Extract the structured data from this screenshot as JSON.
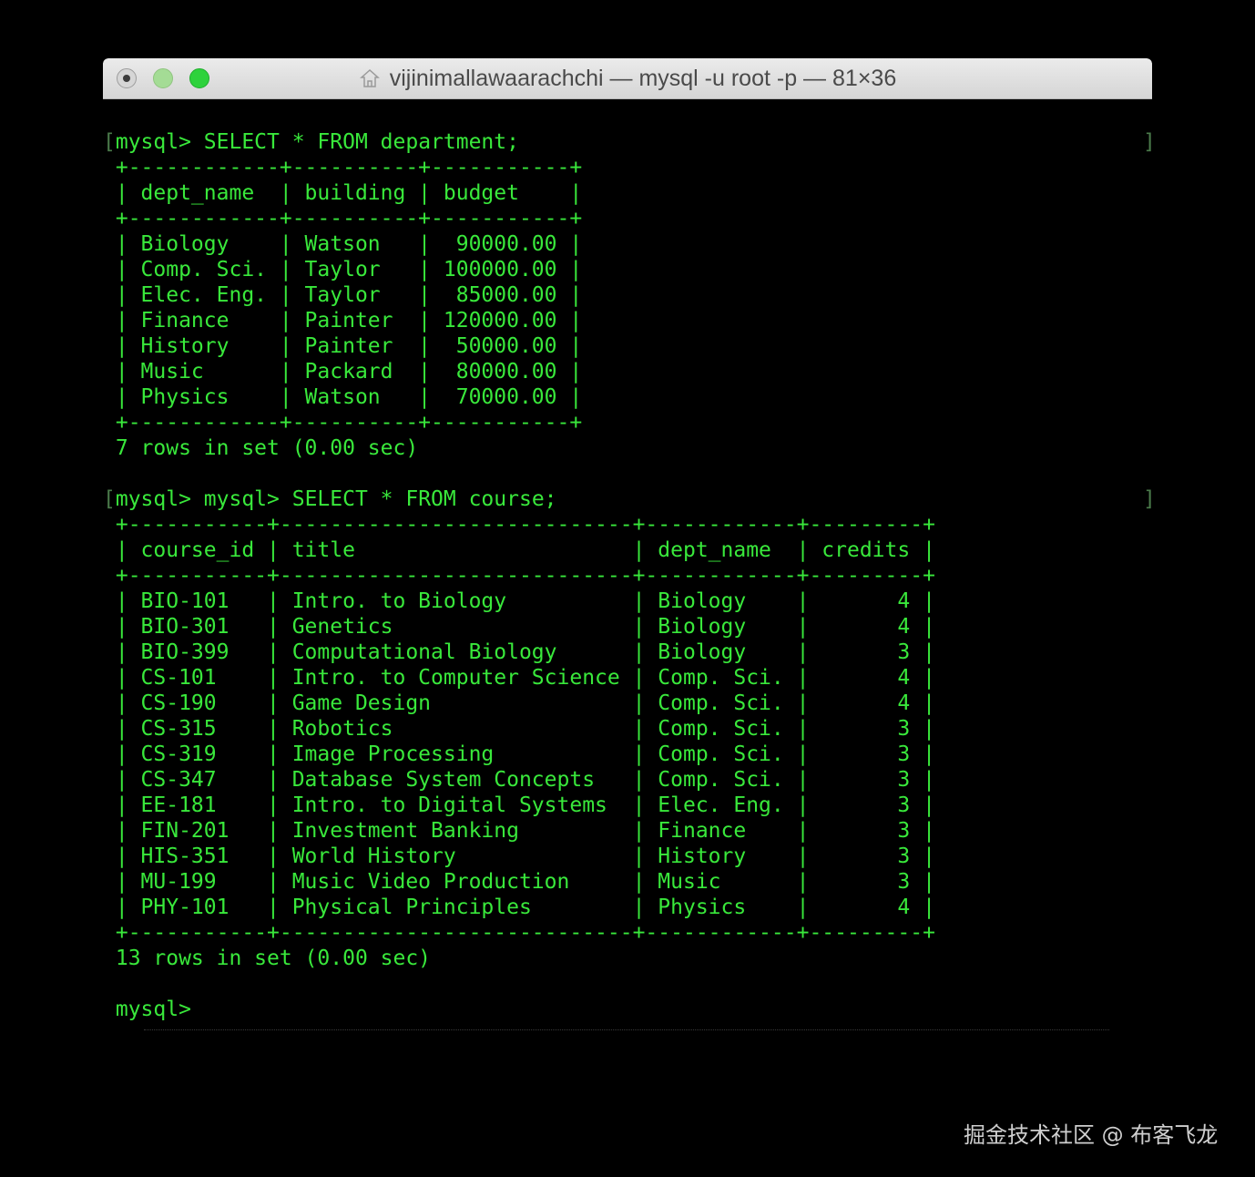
{
  "window": {
    "title": "vijinimallawaarachchi — mysql -u root -p — 81×36",
    "title_icon": "home-folder-icon"
  },
  "terminal": {
    "lines": [
      {
        "prefix": "[",
        "text": "mysql> SELECT * FROM department;",
        "suffix": "]"
      },
      {
        "text": " +------------+----------+-----------+"
      },
      {
        "text": " | dept_name  | building | budget    |"
      },
      {
        "text": " +------------+----------+-----------+"
      },
      {
        "text": " | Biology    | Watson   |  90000.00 |"
      },
      {
        "text": " | Comp. Sci. | Taylor   | 100000.00 |"
      },
      {
        "text": " | Elec. Eng. | Taylor   |  85000.00 |"
      },
      {
        "text": " | Finance    | Painter  | 120000.00 |"
      },
      {
        "text": " | History    | Painter  |  50000.00 |"
      },
      {
        "text": " | Music      | Packard  |  80000.00 |"
      },
      {
        "text": " | Physics    | Watson   |  70000.00 |"
      },
      {
        "text": " +------------+----------+-----------+"
      },
      {
        "text": " 7 rows in set (0.00 sec)"
      },
      {
        "text": ""
      },
      {
        "prefix": "[",
        "text": "mysql> mysql> SELECT * FROM course;",
        "suffix": "]"
      },
      {
        "text": " +-----------+----------------------------+------------+---------+"
      },
      {
        "text": " | course_id | title                      | dept_name  | credits |"
      },
      {
        "text": " +-----------+----------------------------+------------+---------+"
      },
      {
        "text": " | BIO-101   | Intro. to Biology          | Biology    |       4 |"
      },
      {
        "text": " | BIO-301   | Genetics                   | Biology    |       4 |"
      },
      {
        "text": " | BIO-399   | Computational Biology      | Biology    |       3 |"
      },
      {
        "text": " | CS-101    | Intro. to Computer Science | Comp. Sci. |       4 |"
      },
      {
        "text": " | CS-190    | Game Design                | Comp. Sci. |       4 |"
      },
      {
        "text": " | CS-315    | Robotics                   | Comp. Sci. |       3 |"
      },
      {
        "text": " | CS-319    | Image Processing           | Comp. Sci. |       3 |"
      },
      {
        "text": " | CS-347    | Database System Concepts   | Comp. Sci. |       3 |"
      },
      {
        "text": " | EE-181    | Intro. to Digital Systems  | Elec. Eng. |       3 |"
      },
      {
        "text": " | FIN-201   | Investment Banking         | Finance    |       3 |"
      },
      {
        "text": " | HIS-351   | World History              | History    |       3 |"
      },
      {
        "text": " | MU-199    | Music Video Production     | Music      |       3 |"
      },
      {
        "text": " | PHY-101   | Physical Principles        | Physics    |       4 |"
      },
      {
        "text": " +-----------+----------------------------+------------+---------+"
      },
      {
        "text": " 13 rows in set (0.00 sec)"
      },
      {
        "text": ""
      },
      {
        "text": " mysql> "
      }
    ]
  },
  "watermark": "掘金技术社区 @ 布客飞龙",
  "colors": {
    "terminal_bg": "#000000",
    "terminal_text": "#39e83b",
    "titlebar": "#e0e0e0",
    "title_text": "#4a4a4a"
  }
}
